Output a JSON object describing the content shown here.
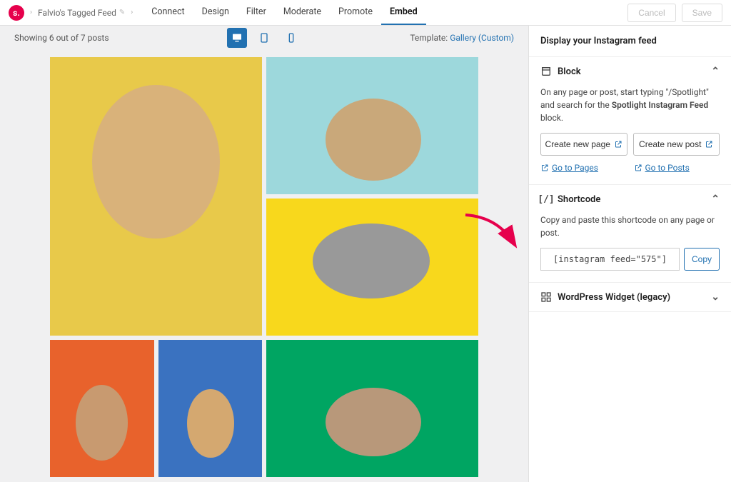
{
  "logo_letter": "s.",
  "breadcrumb_name": "Falvio's Tagged Feed",
  "tabs": [
    "Connect",
    "Design",
    "Filter",
    "Moderate",
    "Promote",
    "Embed"
  ],
  "active_tab": "Embed",
  "cancel_label": "Cancel",
  "save_label": "Save",
  "status_text": "Showing 6 out of 7 posts",
  "template_label": "Template:",
  "template_value": "Gallery (Custom)",
  "sidebar_heading": "Display your Instagram feed",
  "block": {
    "title": "Block",
    "desc_prefix": "On any page or post, start typing \"/Spotlight\" and search for the ",
    "desc_bold": "Spotlight Instagram Feed",
    "desc_suffix": " block.",
    "btn_page": "Create new page",
    "btn_post": "Create new post",
    "link_pages": "Go to Pages",
    "link_posts": "Go to Posts"
  },
  "shortcode": {
    "title": "Shortcode",
    "desc": "Copy and paste this shortcode on any page or post.",
    "value": "[instagram feed=\"575\"]",
    "copy": "Copy"
  },
  "widget": {
    "title": "WordPress Widget (legacy)"
  }
}
